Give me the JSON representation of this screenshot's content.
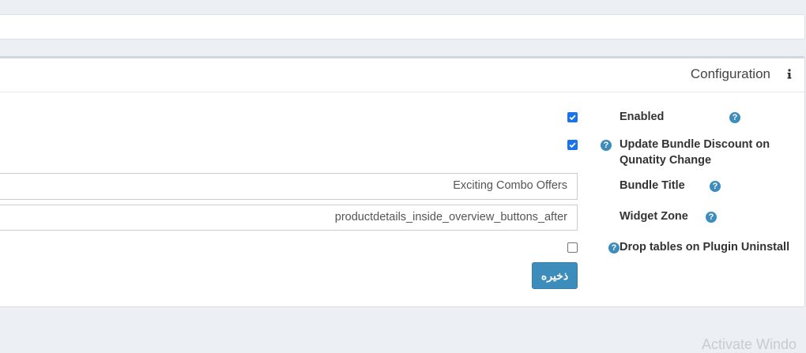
{
  "card": {
    "title": "Configuration",
    "info_icon": "info-icon"
  },
  "form": {
    "enabled": {
      "label": "Enabled",
      "checked": true
    },
    "update_bundle_discount": {
      "label_line1": "Update Bundle Discount on",
      "label_line2": "Qunatity Change",
      "checked": true
    },
    "bundle_title": {
      "label": "Bundle Title",
      "value": "Exciting Combo Offers"
    },
    "widget_zone": {
      "label": "Widget Zone",
      "value": "productdetails_inside_overview_buttons_after"
    },
    "drop_tables": {
      "label": "Drop tables on Plugin Uninstall",
      "checked": false
    },
    "help_glyph": "?",
    "save_label": "ذخیره"
  },
  "watermark": "Activate Windo",
  "colors": {
    "accent": "#3c8dbc",
    "checkbox": "#1a73e8",
    "background": "#eceff3"
  }
}
